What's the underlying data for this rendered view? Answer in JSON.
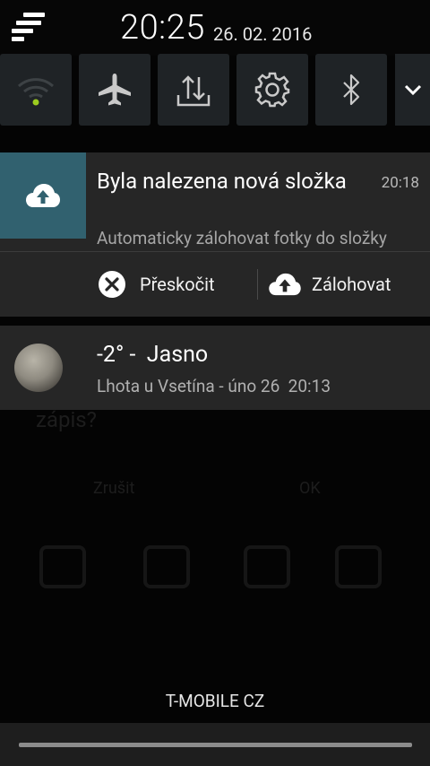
{
  "header": {
    "time": "20:25",
    "date": "26. 02. 2016"
  },
  "quick_settings": [
    {
      "icon": "wifi-icon",
      "active": true
    },
    {
      "icon": "airplane-icon",
      "active": false
    },
    {
      "icon": "data-transfer-icon",
      "active": false
    },
    {
      "icon": "gear-icon",
      "active": false
    },
    {
      "icon": "bluetooth-icon",
      "active": false
    },
    {
      "icon": "chevron-down-icon"
    }
  ],
  "notification_backup": {
    "title": "Byla nalezena nová složka",
    "time": "20:18",
    "text": "Automaticky zálohovat fotky do složky",
    "actions": {
      "skip_label": "Přeskočit",
      "backup_label": "Zálohovat"
    }
  },
  "notification_weather": {
    "title": "-2° -  Jasno",
    "subtitle": "Lhota u Vsetína - úno 26  20:13"
  },
  "carrier": "T-MOBILE CZ",
  "background_app": {
    "dialog_text": "zápis?",
    "cancel_label": "Zrušit",
    "ok_label": "OK"
  },
  "colors": {
    "accent_teal": "#31616f",
    "wifi_dot": "#9ccc1f",
    "panel": "#262626",
    "toggle_bg": "#1f2326"
  }
}
